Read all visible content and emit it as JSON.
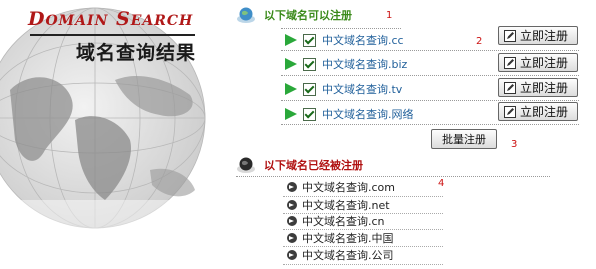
{
  "brand": {
    "title_big_1": "D",
    "title_small_1": "OMAIN",
    "title_big_2": "S",
    "title_small_2": "EARCH",
    "subtitle": "域名查询结果"
  },
  "available": {
    "title": "以下域名可以注册",
    "marker_title": "1",
    "marker_list": "2",
    "items": [
      {
        "domain": "中文域名查询.cc",
        "button": "立即注册"
      },
      {
        "domain": "中文域名查询.biz",
        "button": "立即注册"
      },
      {
        "domain": "中文域名查询.tv",
        "button": "立即注册"
      },
      {
        "domain": "中文域名查询.网络",
        "button": "立即注册"
      }
    ],
    "batch_button": "批量注册",
    "marker_batch": "3"
  },
  "taken": {
    "title": "以下域名已经被注册",
    "marker": "4",
    "items": [
      {
        "domain": "中文域名查询.com"
      },
      {
        "domain": "中文域名查询.net"
      },
      {
        "domain": "中文域名查询.cn"
      },
      {
        "domain": "中文域名查询.中国"
      },
      {
        "domain": "中文域名查询.公司"
      }
    ]
  },
  "colors": {
    "brand_red": "#b01818",
    "available_green": "#3a8a1a",
    "taken_red": "#b01010",
    "link_blue": "#1f5f9a",
    "arrow_green": "#2aa83a"
  },
  "icons": {
    "section": "globe-icon",
    "arrow": "play-arrow-icon",
    "checkbox": "checkbox-checked-icon",
    "button": "edit-icon",
    "taken": "arrow-circle-icon"
  }
}
